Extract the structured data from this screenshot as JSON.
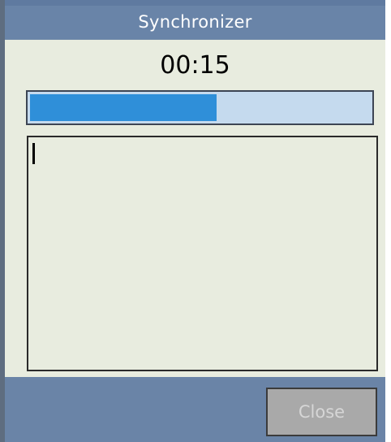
{
  "window": {
    "title": "Synchronizer"
  },
  "status": {
    "elapsed_time": "00:15",
    "progress_fraction": 0.55
  },
  "log": {
    "text": ""
  },
  "footer": {
    "close_label": "Close",
    "close_enabled": false
  },
  "colors": {
    "title_bar": "#6984a8",
    "body_background": "#e8ecdf",
    "progress_fill": "#2f8fd9",
    "progress_track": "#c5daee",
    "button_disabled": "#a9a9a9"
  }
}
